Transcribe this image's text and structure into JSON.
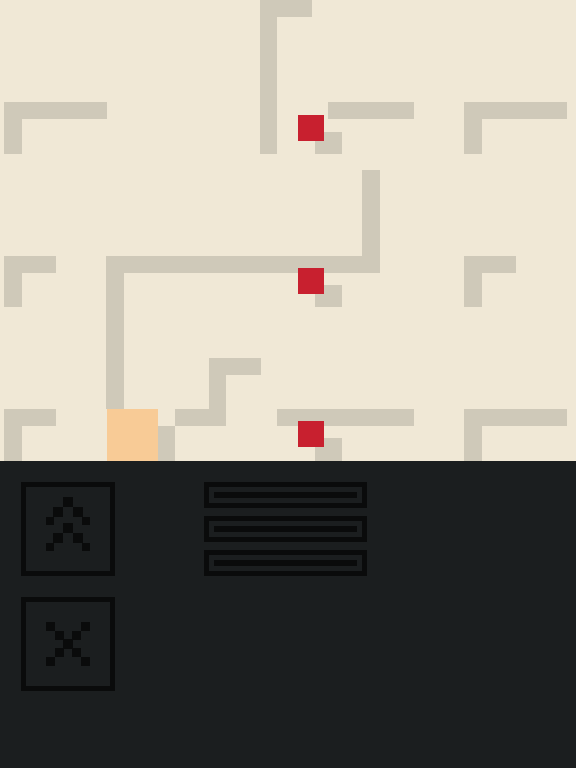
{
  "colors": {
    "board_bg": "#f0e8d6",
    "wall": "#cfc9b9",
    "enemy": "#c8202f",
    "player": "#f8cb96",
    "panel_bg": "#1b1e1f",
    "ui_dark": "#0a0b0b"
  },
  "controls": {
    "move_up": {
      "icon": "chevron-up-icon"
    },
    "cancel": {
      "icon": "close-icon"
    },
    "menu": {
      "icon": "menu-icon",
      "bars": 3
    }
  }
}
